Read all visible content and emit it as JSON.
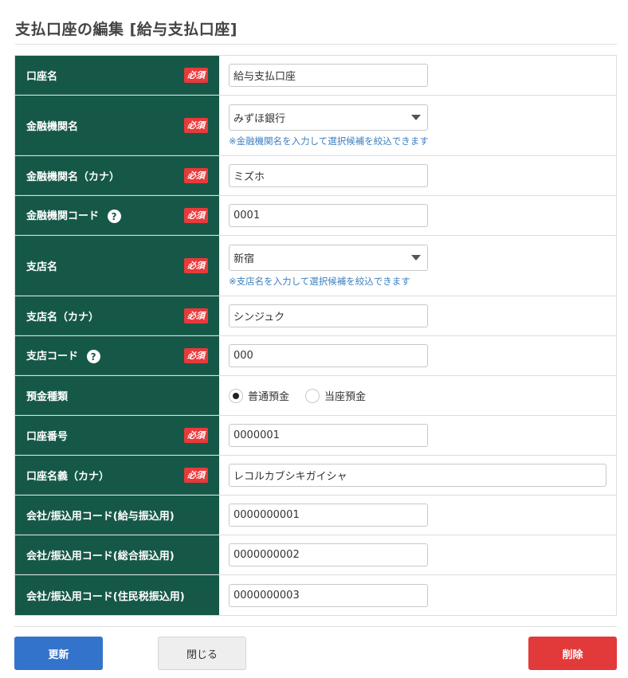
{
  "page": {
    "title": "支払口座の編集 [給与支払口座]"
  },
  "required_label": "必須",
  "help_glyph": "?",
  "fields": [
    {
      "label": "口座名",
      "value": "給与支払口座"
    },
    {
      "label": "金融機関名",
      "value": "みずほ銀行",
      "hint": "※金融機関名を入力して選択候補を絞込できます"
    },
    {
      "label": "金融機関名（カナ）",
      "value": "ミズホ"
    },
    {
      "label": "金融機関コード",
      "value": "0001"
    },
    {
      "label": "支店名",
      "value": "新宿",
      "hint": "※支店名を入力して選択候補を絞込できます"
    },
    {
      "label": "支店名（カナ）",
      "value": "シンジュク"
    },
    {
      "label": "支店コード",
      "value": "000"
    },
    {
      "label": "預金種類",
      "options": [
        "普通預金",
        "当座預金"
      ],
      "selected": "普通預金"
    },
    {
      "label": "口座番号",
      "value": "0000001"
    },
    {
      "label": "口座名義（カナ）",
      "value": "レコルカブシキガイシャ"
    },
    {
      "label": "会社/振込用コード(給与振込用)",
      "value": "0000000001"
    },
    {
      "label": "会社/振込用コード(総合振込用)",
      "value": "0000000002"
    },
    {
      "label": "会社/振込用コード(住民税振込用)",
      "value": "0000000003"
    }
  ],
  "buttons": {
    "update": "更新",
    "close": "閉じる",
    "delete": "削除"
  },
  "colors": {
    "label_bg": "#165848",
    "required_bg": "#e8393b",
    "update_btn": "#3473cb",
    "delete_btn": "#e23a3a",
    "hint_text": "#3a7fc0"
  }
}
